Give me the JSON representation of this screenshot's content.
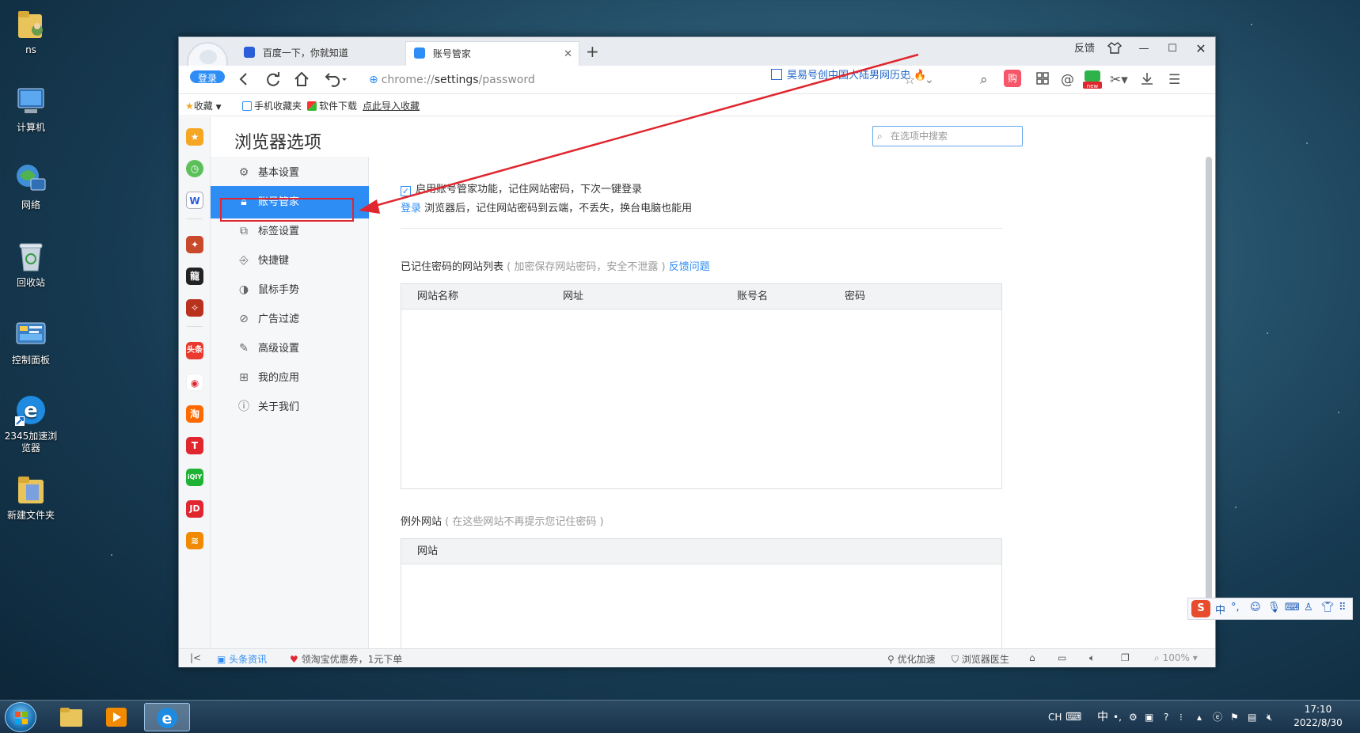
{
  "desktop": {
    "icons": [
      {
        "label": "ns"
      },
      {
        "label": "计算机"
      },
      {
        "label": "网络"
      },
      {
        "label": "回收站"
      },
      {
        "label": "控制面板"
      },
      {
        "label": "2345加速浏览器"
      },
      {
        "label": "新建文件夹"
      }
    ]
  },
  "browser": {
    "login_badge": "登录",
    "tabs": [
      {
        "label": "百度一下，你就知道"
      },
      {
        "label": "账号管家"
      }
    ],
    "new_tab": "+",
    "feedback": "反馈",
    "address": {
      "scheme": "chrome://",
      "host": "settings",
      "path": "/password"
    },
    "news_headline": "昊易号创中国大陆男网历史",
    "bookmarks": {
      "favorites": "收藏",
      "items": [
        "手机收藏夹",
        "软件下载",
        "点此导入收藏"
      ]
    },
    "quickbar": [
      "头条",
      "淘",
      "T",
      "iQIY",
      "JD"
    ],
    "status": {
      "news": "头条资讯",
      "coupon": "领淘宝优惠券，1元下单",
      "optimize": "优化加速",
      "doctor": "浏览器医生",
      "zoom": "100%"
    }
  },
  "settings": {
    "title": "浏览器选项",
    "search_placeholder": "在选项中搜索",
    "menu": [
      {
        "label": "基本设置",
        "icon": "gear-icon"
      },
      {
        "label": "账号管家",
        "icon": "lock-icon"
      },
      {
        "label": "标签设置",
        "icon": "tabs-icon"
      },
      {
        "label": "快捷键",
        "icon": "keyboard-icon"
      },
      {
        "label": "鼠标手势",
        "icon": "mouse-icon"
      },
      {
        "label": "广告过滤",
        "icon": "block-icon"
      },
      {
        "label": "高级设置",
        "icon": "wrench-icon"
      },
      {
        "label": "我的应用",
        "icon": "apps-icon"
      },
      {
        "label": "关于我们",
        "icon": "info-icon"
      }
    ],
    "active_menu": "账号管家",
    "enable_label": "启用账号管家功能，记住网站密码，下次一键登录",
    "login_link": "登录",
    "login_desc": "浏览器后，记住网站密码到云端，不丢失，换台电脑也能用",
    "saved_title": "已记住密码的网站列表",
    "saved_note": "( 加密保存网站密码，安全不泄露 )",
    "feedback_link": "反馈问题",
    "saved_columns": [
      "网站名称",
      "网址",
      "账号名",
      "密码"
    ],
    "exceptions_title": "例外网站",
    "exceptions_note": "( 在这些网站不再提示您记住密码 )",
    "exceptions_columns": [
      "网站"
    ]
  },
  "ime": {
    "logo": "S",
    "mode": "中"
  },
  "taskbar": {
    "tray_lang": "CH",
    "tray_ime": "中",
    "time": "17:10",
    "date": "2022/8/30"
  },
  "colors": {
    "accent": "#2e8df5",
    "highlight": "#e0262e"
  }
}
